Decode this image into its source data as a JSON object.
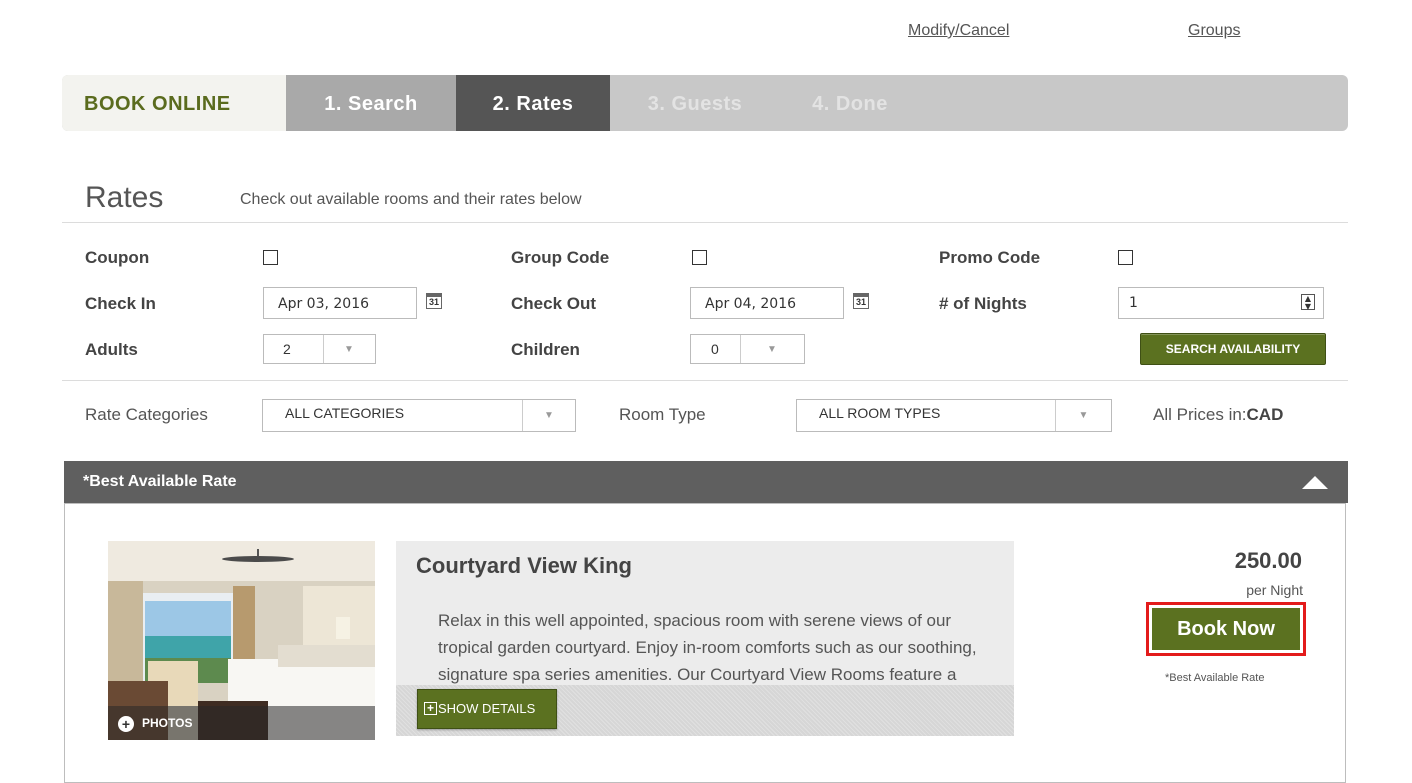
{
  "top_links": {
    "modify": "Modify/Cancel",
    "groups": "Groups"
  },
  "steps": {
    "book_online": "BOOK ONLINE",
    "items": [
      "1. Search",
      "2. Rates",
      "3. Guests",
      "4. Done"
    ],
    "active_index": 1
  },
  "header": {
    "title": "Rates",
    "subtitle": "Check out available rooms and their rates below"
  },
  "form": {
    "coupon_label": "Coupon",
    "group_code_label": "Group Code",
    "promo_code_label": "Promo Code",
    "check_in_label": "Check In",
    "check_in_value": "Apr 03, 2016",
    "check_out_label": "Check Out",
    "check_out_value": "Apr 04, 2016",
    "nights_label": "# of Nights",
    "nights_value": "1",
    "adults_label": "Adults",
    "adults_value": "2",
    "children_label": "Children",
    "children_value": "0",
    "calendar_day": "31",
    "search_button": "SEARCH AVAILABILITY"
  },
  "filters": {
    "rate_categories_label": "Rate Categories",
    "rate_categories_value": "ALL CATEGORIES",
    "room_type_label": "Room Type",
    "room_type_value": "ALL ROOM TYPES",
    "prices_label": "All Prices in:",
    "currency": "CAD"
  },
  "rate_section": {
    "title": "*Best Available Rate",
    "room": {
      "name": "Courtyard View King",
      "description": "Relax in this well appointed, spacious room with serene views of our tropical garden courtyard. Enjoy in-room comforts such as our soothing, signature spa series amenities. Our Courtyard View Rooms feature a",
      "photos_label": "PHOTOS",
      "show_details": "SHOW DETAILS",
      "price": "250.00",
      "per_night": "per Night",
      "book_button": "Book Now",
      "rate_note": "*Best Available Rate"
    }
  },
  "colors": {
    "brand_green": "#5b7120",
    "active_step": "#555555",
    "highlight_red": "#e31b1b"
  }
}
